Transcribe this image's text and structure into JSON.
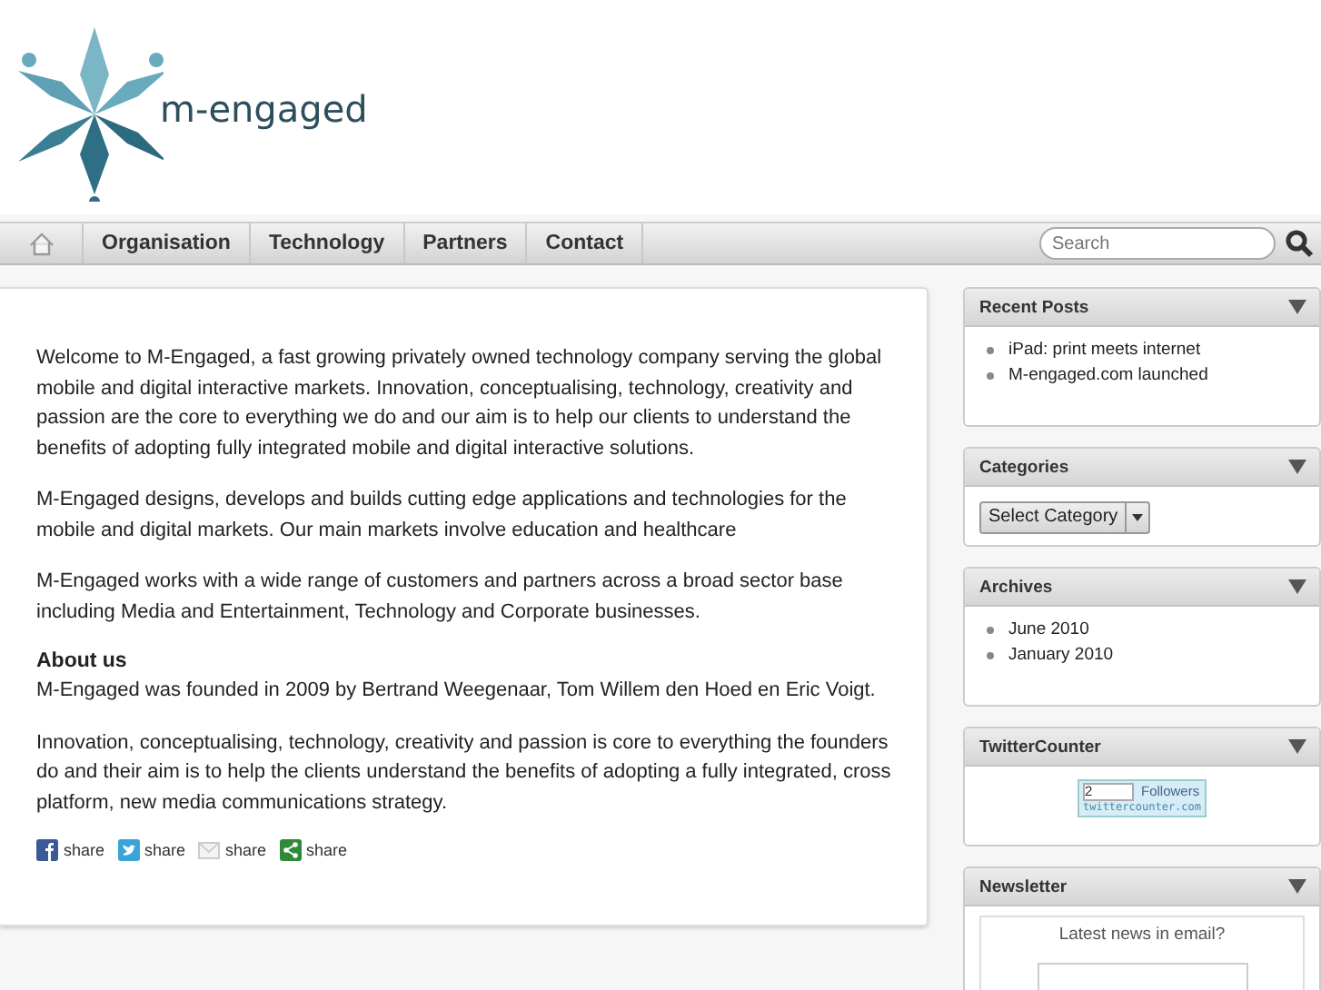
{
  "logo": {
    "text": "m-engaged"
  },
  "nav": {
    "items": [
      {
        "label": "Organisation"
      },
      {
        "label": "Technology"
      },
      {
        "label": "Partners"
      },
      {
        "label": "Contact"
      }
    ]
  },
  "search": {
    "placeholder": "Search"
  },
  "content": {
    "paragraphs": [
      {
        "kind": "text",
        "text": "Welcome to M-Engaged, a fast growing privately owned technology company serving the global mobile and digital interactive markets.  Innovation, conceptualising, technology, creativity and passion are the core to everything we do and our aim is to help our clients to understand the benefits of adopting fully integrated mobile and digital interactive solutions."
      },
      {
        "kind": "text",
        "text": "M-Engaged designs, develops and builds cutting edge applications and technologies for the mobile and digital markets. Our main markets involve education and healthcare"
      },
      {
        "kind": "text",
        "text": "M-Engaged works with a wide range of customers and partners across a broad sector base including Media and Entertainment, Technology and Corporate businesses."
      },
      {
        "kind": "heading",
        "text": "About us"
      },
      {
        "kind": "text",
        "text": "M-Engaged was founded in 2009 by Bertrand Weegenaar, Tom Willem den Hoed en Eric Voigt."
      },
      {
        "kind": "text",
        "text": "Innovation, conceptualising, technology, creativity and passion is core to everything the founders do and their aim is to help the clients understand the benefits of adopting a fully integrated, cross platform, new media communications strategy."
      }
    ],
    "share": [
      {
        "kind": "facebook",
        "label": "share"
      },
      {
        "kind": "twitter",
        "label": "share"
      },
      {
        "kind": "email",
        "label": "share"
      },
      {
        "kind": "share",
        "label": "share"
      }
    ]
  },
  "sidebar": [
    {
      "kind": "list",
      "title": "Recent Posts",
      "items": [
        "iPad: print meets internet",
        "M-engaged.com launched"
      ]
    },
    {
      "kind": "select",
      "title": "Categories",
      "select": "Select Category"
    },
    {
      "kind": "list",
      "title": "Archives",
      "items": [
        "June 2010",
        "January 2010"
      ]
    },
    {
      "kind": "counter",
      "title": "TwitterCounter",
      "count": "2",
      "unit": "Followers",
      "source": "twittercounter.com"
    },
    {
      "kind": "newsletter",
      "title": "Newsletter",
      "prompt": "Latest news in email?"
    }
  ]
}
